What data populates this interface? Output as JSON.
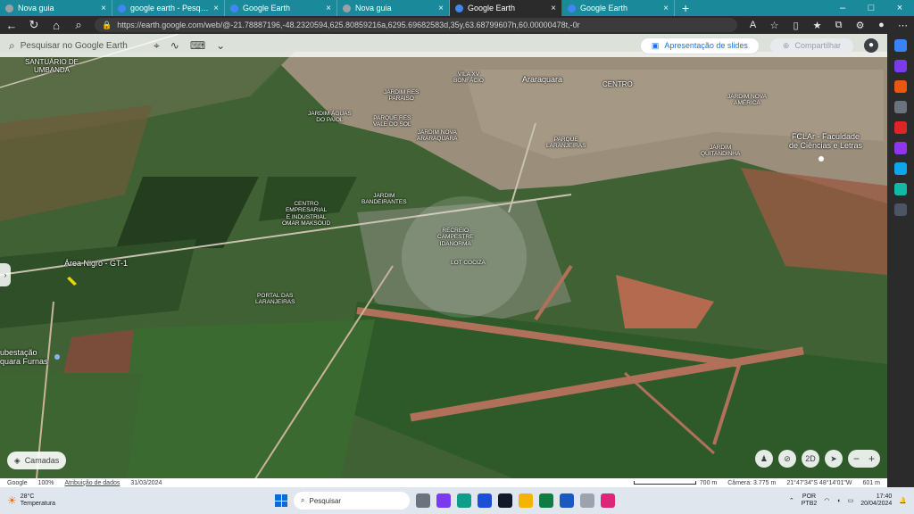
{
  "browser": {
    "tabs": [
      {
        "title": "Nova guia",
        "color": "#9aa0a6",
        "active": false
      },
      {
        "title": "google earth - Pesquisar",
        "color": "#4285f4",
        "active": false
      },
      {
        "title": "Google Earth",
        "color": "#4285f4",
        "active": false
      },
      {
        "title": "Nova guia",
        "color": "#9aa0a6",
        "active": false
      },
      {
        "title": "Google Earth",
        "color": "#4285f4",
        "active": true
      },
      {
        "title": "Google Earth",
        "color": "#4285f4",
        "active": false
      }
    ],
    "url": "https://earth.google.com/web/@-21.78887196,-48.2320594,625.80859216a,6295.69682583d,35y,63.68799607h,60.00000478t,-0r"
  },
  "earth": {
    "search_placeholder": "Pesquisar no Google Earth",
    "slides_label": "Apresentação de slides",
    "share_label": "Compartilhar",
    "layers_label": "Camadas",
    "mode_2d": "2D",
    "status": {
      "google": "Google",
      "percent": "100%",
      "attribution": "Atribuição de dados",
      "date": "31/03/2024",
      "scale_label": "700 m",
      "camera": "Câmera: 3.775 m",
      "coords": "21°47'34\"S 48°14'01\"W",
      "elevation": "601 m"
    },
    "labels": {
      "santuario": "SANTUÁRIO DE\nUMBANDA",
      "vila_bonfacio": "VILA XV\nBONFÁCIO",
      "araraquara": "Araraquara",
      "centro": "CENTRO",
      "jardim_res_paraiso": "JARDIM RES\nPARAISO",
      "jardim_nova_america": "JARDIM NOVA\nAMÉRICA",
      "jardim_aguas": "JARDIM ÁGUAS\nDO PAIOL",
      "parque_res": "PARQUE RES\nVALE DO SOL",
      "jardim_nova_araraquara": "JARDIM NOVA\nARARAQUARA",
      "parque_laranjeiras": "PARQUE\nLARANJEIRAS",
      "fclar": "FCLAr - Faculdade\nde Ciências e Letras",
      "jardim_quitandinha": "JARDIM\nQUITANDINHA",
      "jardim_bandeirantes": "JARDIM\nBANDEIRANTES",
      "centro_empresarial": "CENTRO\nEMPRESARIAL\nE INDUSTRIAL\nOMAR MAKSOUD",
      "recreio": "RECREIO\nCAMPESTRE\nIDANORMA",
      "lot_cociza": "LOT COCIZA",
      "area_nigro": "Área Nigro - GT-1",
      "portal": "PORTAL DAS\nLARANJEIRAS",
      "subestacao": "ubestação\nquara Furnas"
    }
  },
  "taskbar": {
    "temp": "28°C",
    "weather_text": "Temperatura",
    "search_label": "Pesquisar",
    "lang_top": "POR",
    "lang_bottom": "PTB2",
    "time": "17:40",
    "date": "20/04/2024"
  }
}
